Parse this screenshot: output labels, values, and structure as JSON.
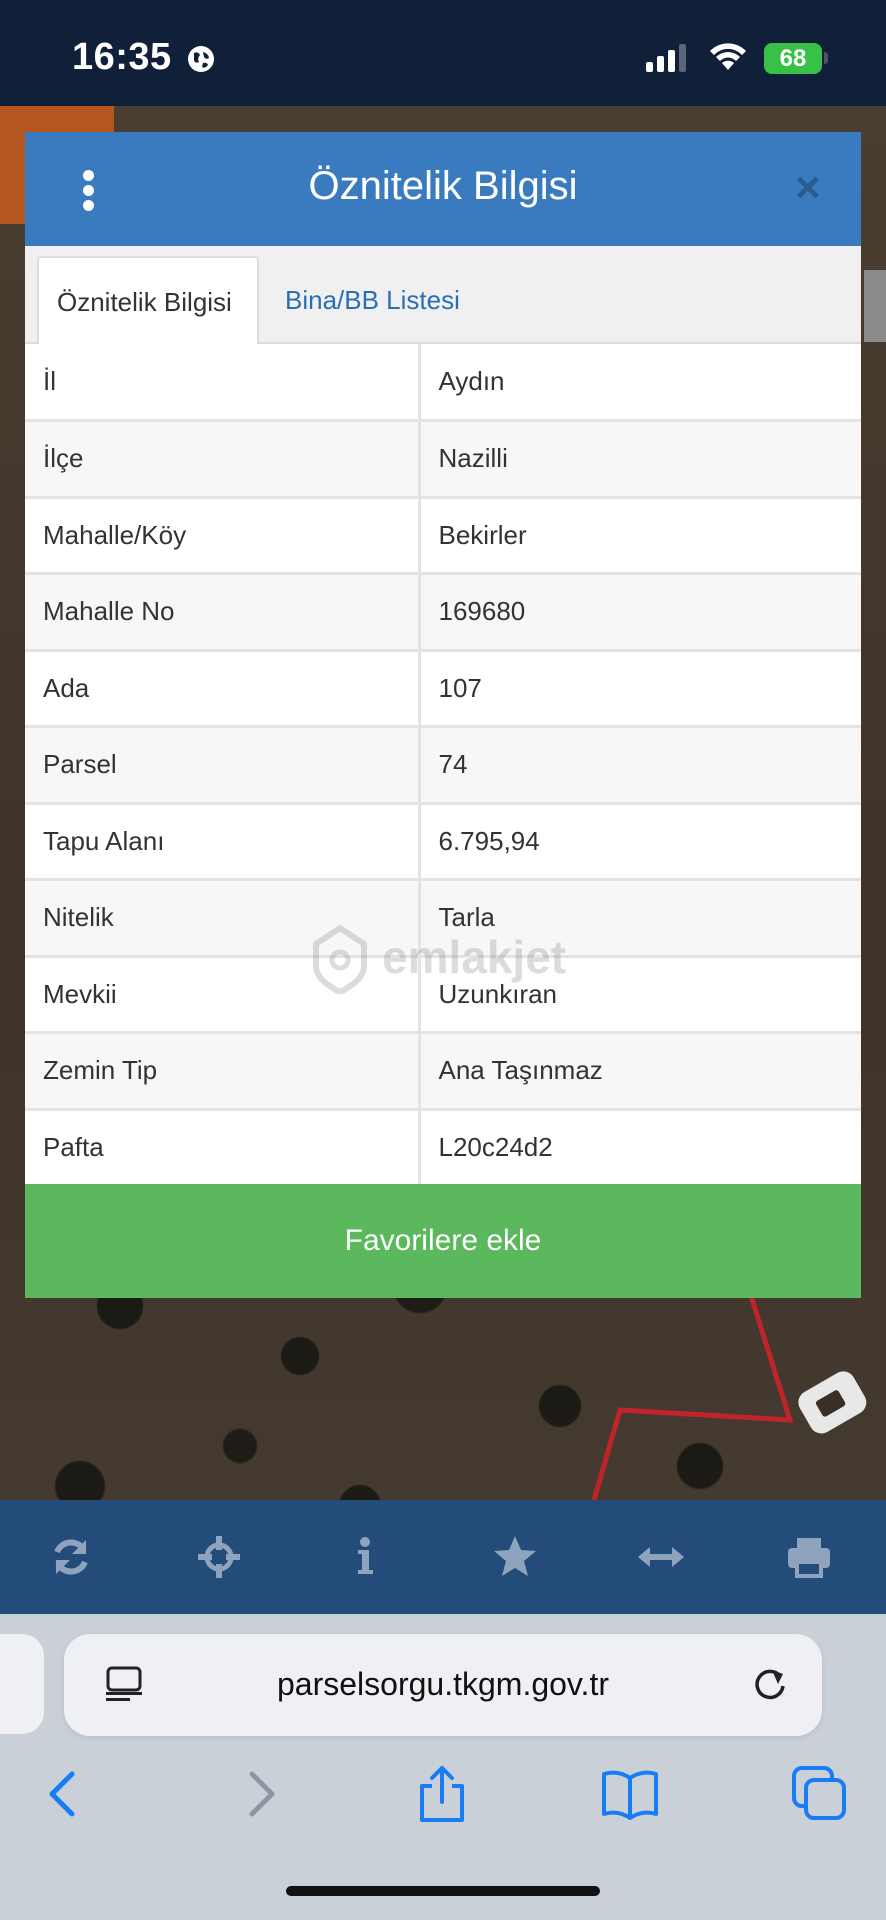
{
  "status_bar": {
    "time": "16:35",
    "battery": "68"
  },
  "modal": {
    "title": "Öznitelik Bilgisi",
    "tabs": [
      {
        "label": "Öznitelik Bilgisi",
        "active": true
      },
      {
        "label": "Bina/BB Listesi",
        "active": false
      }
    ],
    "rows": [
      {
        "key": "İl",
        "value": "Aydın"
      },
      {
        "key": "İlçe",
        "value": "Nazilli"
      },
      {
        "key": "Mahalle/Köy",
        "value": "Bekirler"
      },
      {
        "key": "Mahalle No",
        "value": "169680"
      },
      {
        "key": "Ada",
        "value": "107"
      },
      {
        "key": "Parsel",
        "value": "74"
      },
      {
        "key": "Tapu Alanı",
        "value": "6.795,94"
      },
      {
        "key": "Nitelik",
        "value": "Tarla"
      },
      {
        "key": "Mevkii",
        "value": "Uzunkıran"
      },
      {
        "key": "Zemin Tip",
        "value": "Ana Taşınmaz"
      },
      {
        "key": "Pafta",
        "value": "L20c24d2"
      }
    ],
    "favorite_button": "Favorilere ekle"
  },
  "watermark": "emlakjet",
  "toolbar_icons": [
    "refresh-icon",
    "crosshair-icon",
    "info-icon",
    "star-icon",
    "measure-icon",
    "print-icon"
  ],
  "browser": {
    "url": "parselsorgu.tkgm.gov.tr"
  },
  "colors": {
    "header_blue": "#3a7bbf",
    "button_green": "#5cb85c",
    "toolbar_blue": "#244c7a",
    "tab_link": "#2a6fb3"
  }
}
